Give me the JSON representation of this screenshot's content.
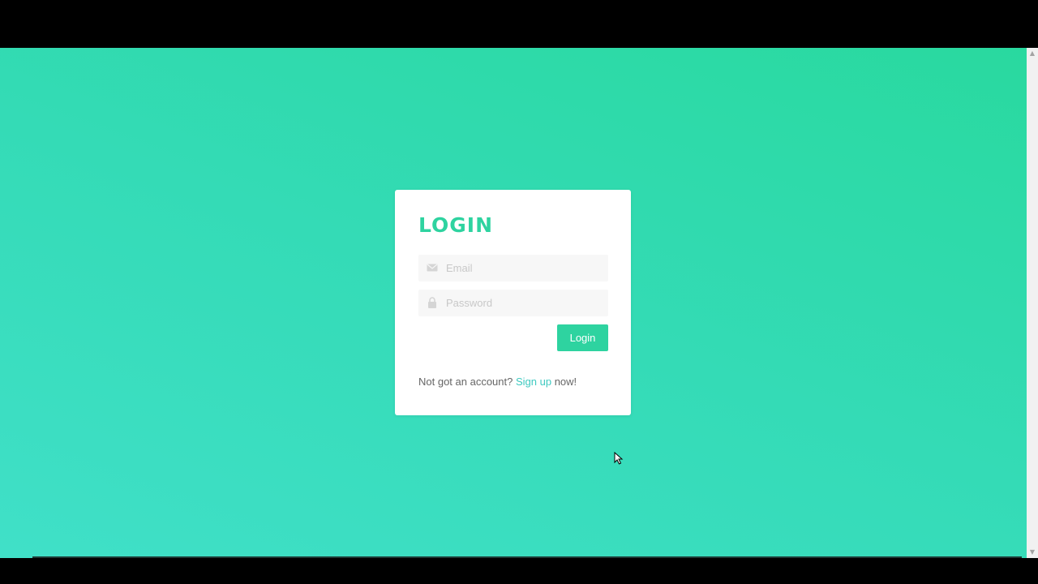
{
  "login_card": {
    "title": "LOGIN",
    "email": {
      "icon": "envelope-icon",
      "placeholder": "Email",
      "value": ""
    },
    "password": {
      "icon": "lock-icon",
      "placeholder": "Password",
      "value": ""
    },
    "submit_label": "Login",
    "signup": {
      "prefix": "Not got an account?",
      "link_label": "Sign up",
      "suffix": "now!"
    }
  },
  "colors": {
    "accent": "#2ed3a0",
    "link": "#3ec9c0",
    "background_start": "#40e0c8",
    "background_end": "#29d99f",
    "card": "#ffffff",
    "field_bg": "#f7f7f7"
  },
  "scrollbar": {
    "up_icon": "chevron-up-icon",
    "down_icon": "chevron-down-icon"
  }
}
